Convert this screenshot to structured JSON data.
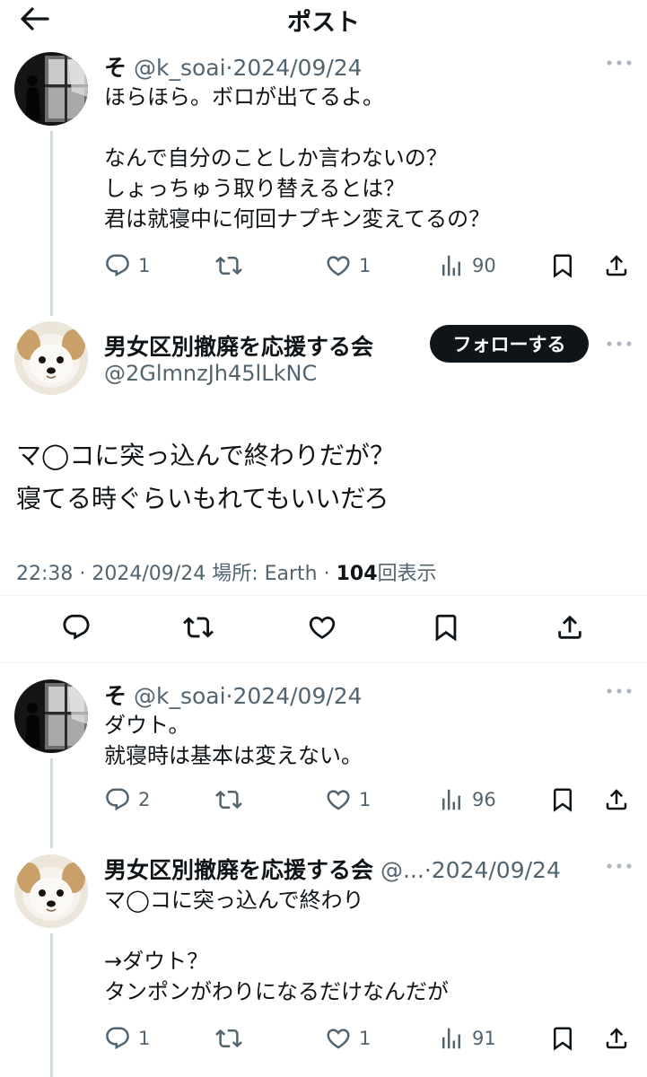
{
  "header": {
    "title": "ポスト",
    "back_icon": "arrow-left-icon"
  },
  "post1": {
    "name": "そ",
    "handle": "@k_soai",
    "date": "2024/09/24",
    "text": "ほらほら。ボロが出てるよ。\n\nなんで自分のことしか言わないの？\nしょっちゅう取り替えるとは？\n君は就寝中に何回ナプキン変えてるの？",
    "replies": "1",
    "retweets": "",
    "likes": "1",
    "views": "90"
  },
  "main_post": {
    "name": "男女区別撤廃を応援する会",
    "handle": "@2GlmnzJh45lLkNC",
    "follow_label": "フォローする",
    "text": "マ◯コに突っ込んで終わりだが？\n寝てる時ぐらいもれてもいいだろ",
    "time": "22:38",
    "date": "2024/09/24",
    "location_label": "場所: Earth",
    "views_count": "104",
    "views_label": "回表示"
  },
  "reply1": {
    "name": "そ",
    "handle": "@k_soai",
    "date": "2024/09/24",
    "text": "ダウト。\n就寝時は基本は変えない。",
    "replies": "2",
    "retweets": "",
    "likes": "1",
    "views": "96"
  },
  "reply2": {
    "name": "男女区別撤廃を応援する会",
    "handle": "@...",
    "date": "2024/09/24",
    "text": "マ◯コに突っ込んで終わり\n\n→ダウト？\nタンポンがわりになるだけなんだが",
    "replies": "1",
    "retweets": "",
    "likes": "1",
    "views": "91"
  },
  "separator": "·",
  "icons": [
    "reply-icon",
    "retweet-icon",
    "like-icon",
    "views-icon",
    "bookmark-icon",
    "share-icon",
    "more-icon"
  ],
  "colors": {
    "text": "#0f1419",
    "muted": "#536471",
    "line": "#cfd9de",
    "follow_bg": "#0f1419"
  }
}
